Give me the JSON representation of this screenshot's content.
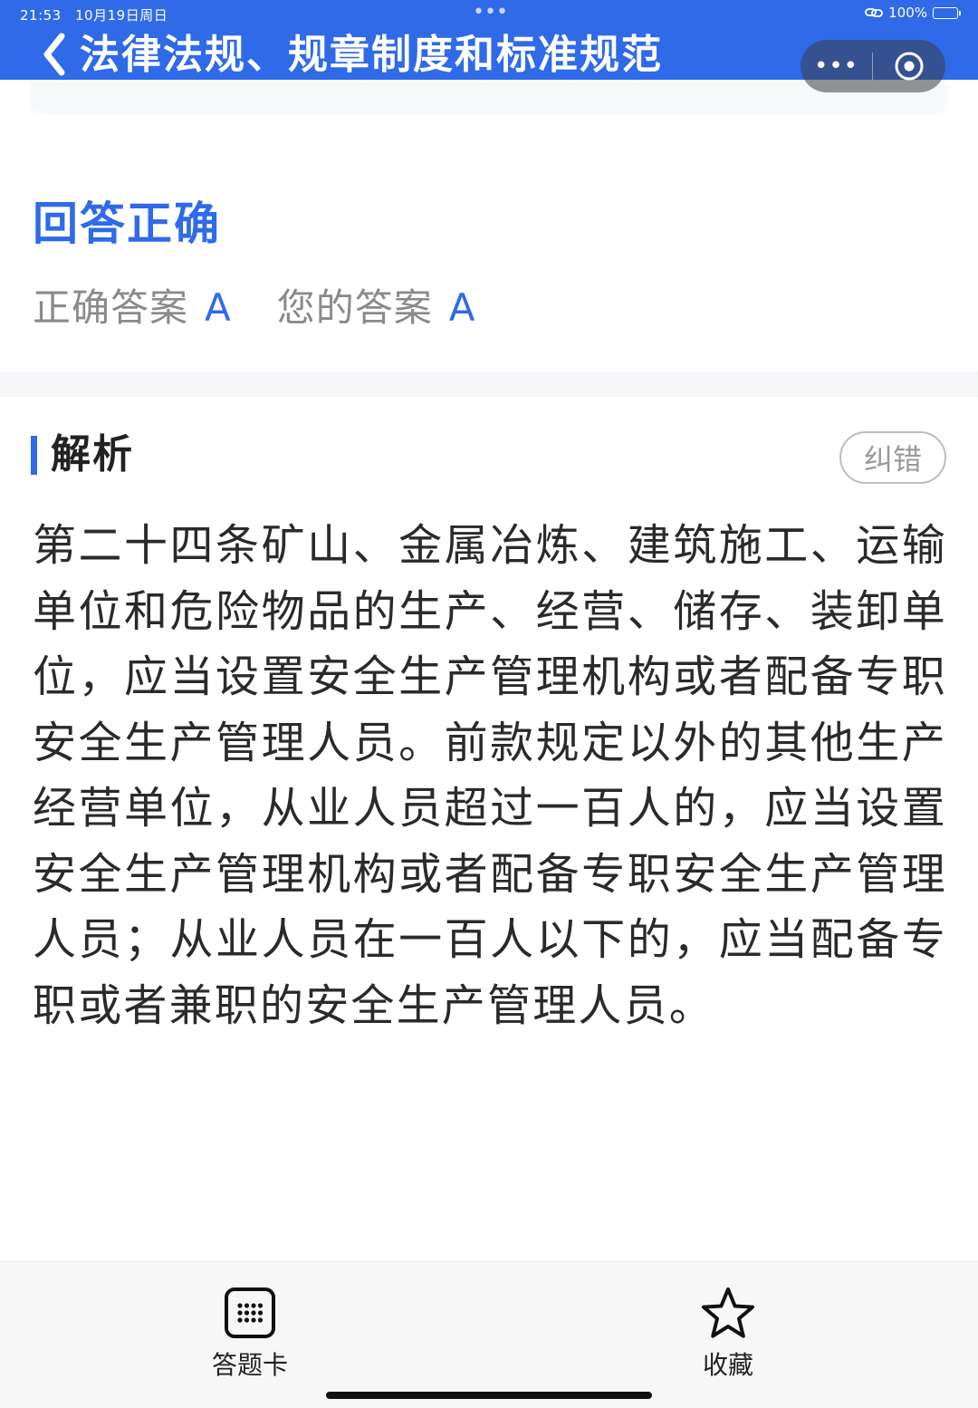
{
  "status_bar": {
    "time": "21:53",
    "date": "10月19日周日",
    "center_dots": "•••",
    "battery": "100%"
  },
  "nav": {
    "title": "法律法规、规章制度和标准规范",
    "capsule_more": "•••"
  },
  "result": {
    "title": "回答正确",
    "correct_label": "正确答案",
    "correct_value": "A",
    "your_label": "您的答案",
    "your_value": "A"
  },
  "analysis": {
    "title": "解析",
    "report_button": "纠错",
    "text": "第二十四条矿山、金属冶炼、建筑施工、运输单位和危险物品的生产、经营、储存、装卸单位，应当设置安全生产管理机构或者配备专职安全生产管理人员。前款规定以外的其他生产经营单位，从业人员超过一百人的，应当设置安全生产管理机构或者配备专职安全生产管理人员；从业人员在一百人以下的，应当配备专职或者兼职的安全生产管理人员。"
  },
  "toolbar": {
    "answer_card_label": "答题卡",
    "favorite_label": "收藏"
  },
  "colors": {
    "accent": "#2f6ae8",
    "muted_text": "#8a8a8a"
  },
  "icons": {
    "back": "chevron-left-icon",
    "more": "more-dots-icon",
    "close": "target-circle-icon",
    "answer_card": "grid-card-icon",
    "favorite": "star-outline-icon"
  }
}
